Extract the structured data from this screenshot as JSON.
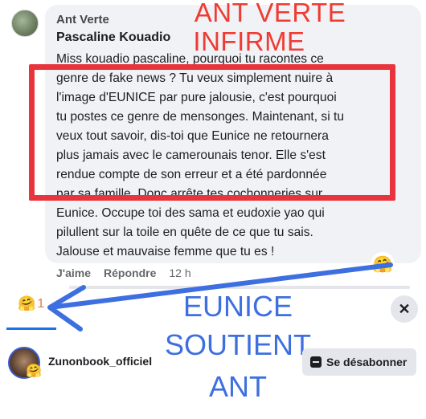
{
  "comment": {
    "author": "Ant Verte",
    "addressee": "Pascaline Kouadio",
    "lines": [
      "Miss kouadio pascaline, pourquoi tu racontes ce",
      "genre de fake news ? Tu veux simplement nuire à",
      "l'image d'EUNICE par pure jalousie, c'est pourquoi",
      "tu postes ce genre de mensonges. Maintenant, si tu",
      "veux tout savoir, dis-toi que Eunice ne retournera",
      "plus jamais avec le camerounais tenor. Elle s'est",
      "rendue compte de son erreur et a été pardonnée",
      "par sa famille. Donc arrête tes cochonneries sur",
      "Eunice. Occupe toi des sama et eudoxie yao qui",
      "pilullent sur la toile en quête de ce que tu sais.",
      "Jalouse et mauvaise femme que tu es !"
    ],
    "like_label": "J'aime",
    "reply_label": "Répondre",
    "time": "12 h",
    "reaction_icon": "care-emoji",
    "reaction_glyph": "🤗"
  },
  "overlay": {
    "red_line1": "ANT VERTE",
    "red_line2": "INFIRME",
    "blue_line1": "EUNICE",
    "blue_line2": "SOUTIENT",
    "blue_line3": "ANT",
    "red_color": "#ef3b34",
    "blue_color": "#3d6fe0"
  },
  "reactions_panel": {
    "tab_glyph": "🤗",
    "tab_count": "1",
    "close_glyph": "✕",
    "user": {
      "name": "Zunonbook_officiel",
      "reaction_glyph": "🤗"
    },
    "unsubscribe_label": "Se désabonner"
  }
}
